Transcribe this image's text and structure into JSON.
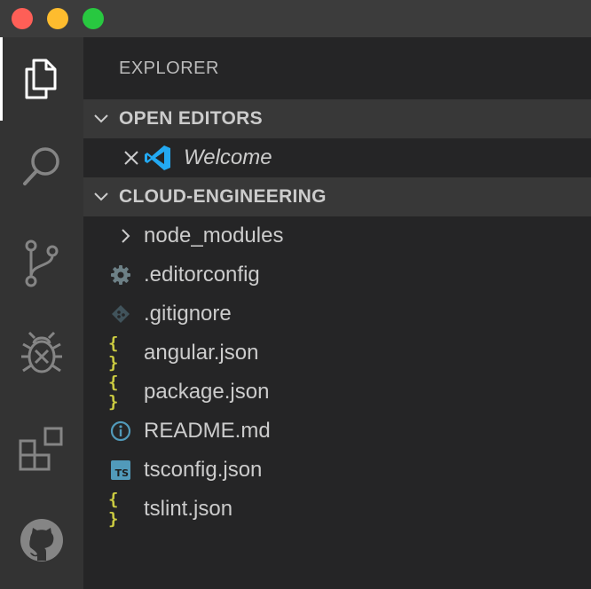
{
  "window": {
    "controls": [
      "close",
      "minimize",
      "maximize"
    ],
    "colors": {
      "close": "#fe5f57",
      "minimize": "#febc2e",
      "maximize": "#28c840"
    }
  },
  "activity_bar": {
    "items": [
      {
        "icon": "files-icon",
        "active": true
      },
      {
        "icon": "search-icon",
        "active": false
      },
      {
        "icon": "source-control-icon",
        "active": false
      },
      {
        "icon": "debug-icon",
        "active": false
      },
      {
        "icon": "extensions-icon",
        "active": false
      },
      {
        "icon": "github-icon",
        "active": false
      }
    ]
  },
  "sidebar": {
    "title": "EXPLORER",
    "open_editors": {
      "header": "OPEN EDITORS",
      "expanded": true,
      "items": [
        {
          "label": "Welcome",
          "icon": "vscode-logo-icon",
          "italic": true
        }
      ]
    },
    "project": {
      "header": "CLOUD-ENGINEERING",
      "expanded": true,
      "items": [
        {
          "label": "node_modules",
          "icon": "chevron-right-icon",
          "type": "folder"
        },
        {
          "label": ".editorconfig",
          "icon": "gear-icon",
          "type": "file"
        },
        {
          "label": ".gitignore",
          "icon": "git-icon",
          "type": "file"
        },
        {
          "label": "angular.json",
          "icon": "json-icon",
          "type": "file"
        },
        {
          "label": "package.json",
          "icon": "json-icon",
          "type": "file"
        },
        {
          "label": "README.md",
          "icon": "info-icon",
          "type": "file"
        },
        {
          "label": "tsconfig.json",
          "icon": "typescript-icon",
          "type": "file",
          "badge": "TS"
        },
        {
          "label": "tslint.json",
          "icon": "json-icon",
          "type": "file"
        }
      ]
    }
  },
  "colors": {
    "titlebar": "#3c3c3c",
    "activity_bar": "#333333",
    "sidebar": "#252526",
    "section_header": "#383838",
    "json_icon": "#cbcb41",
    "info_icon": "#519aba",
    "vscode_blue": "#23a9f2"
  }
}
